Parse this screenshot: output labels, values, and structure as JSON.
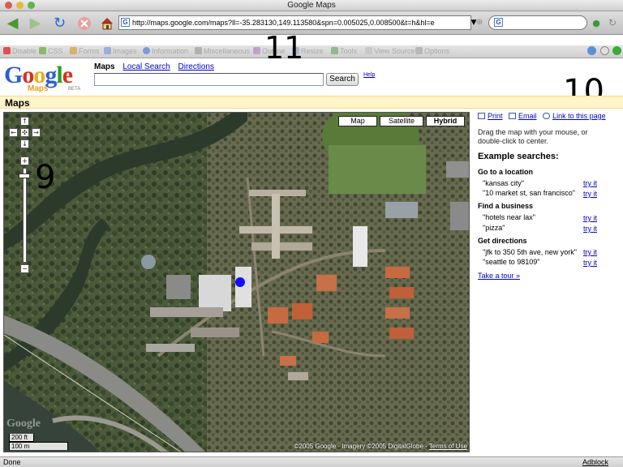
{
  "window": {
    "title": "Google Maps"
  },
  "toolbar": {
    "url": "http://maps.google.com/maps?ll=-35.283130,149.113580&spn=0.005025,0.008500&t=h&hl=e",
    "favicon": "G",
    "search_engine_icon": "G",
    "icons": {
      "back": "back-arrow-icon",
      "forward": "forward-arrow-icon",
      "reload": "reload-icon",
      "stop": "stop-icon",
      "home": "home-icon"
    }
  },
  "devbar": {
    "items": [
      "Disable",
      "CSS",
      "Forms",
      "Images",
      "Information",
      "Miscellaneous",
      "Outline",
      "Resize",
      "Tools",
      "View Source",
      "Options"
    ]
  },
  "annotations": {
    "top": "11",
    "right": "10",
    "map": "9"
  },
  "google": {
    "logo_letters": [
      "G",
      "o",
      "o",
      "g",
      "l",
      "e"
    ],
    "logo_colors": [
      "#2a5ed8",
      "#d8301a",
      "#e8b020",
      "#2a5ed8",
      "#28a028",
      "#d8301a"
    ],
    "logo_sub": "Maps",
    "logo_beta": "BETA",
    "tabs": {
      "current": "Maps",
      "local": "Local Search",
      "directions": "Directions"
    },
    "search_button": "Search",
    "help": "Help"
  },
  "section_title": "Maps",
  "map": {
    "types": [
      "Map",
      "Satellite",
      "Hybrid"
    ],
    "active_type": "Hybrid",
    "zoom_level": 0.05,
    "scale_ft": "200 ft",
    "scale_m": "100 m",
    "copyright": "©2005 Google - Imagery ©2005 DigitalGlobe - ",
    "terms": "Terms of Use",
    "watermark": "Google"
  },
  "sidebar": {
    "print": "Print",
    "email": "Email",
    "link": "Link to this page",
    "drag_text": "Drag the map with your mouse, or double-click to center.",
    "examples_title": "Example searches:",
    "groups": [
      {
        "title": "Go to a location",
        "items": [
          "\"kansas city\"",
          "\"10 market st, san francisco\""
        ]
      },
      {
        "title": "Find a business",
        "items": [
          "\"hotels near lax\"",
          "\"pizza\""
        ]
      },
      {
        "title": "Get directions",
        "items": [
          "\"jfk to 350 5th ave, new york\"",
          "\"seattle to 98109\""
        ]
      }
    ],
    "try_it": "try it",
    "tour": "Take a tour »"
  },
  "status": {
    "left": "Done",
    "right": "Adblock"
  }
}
